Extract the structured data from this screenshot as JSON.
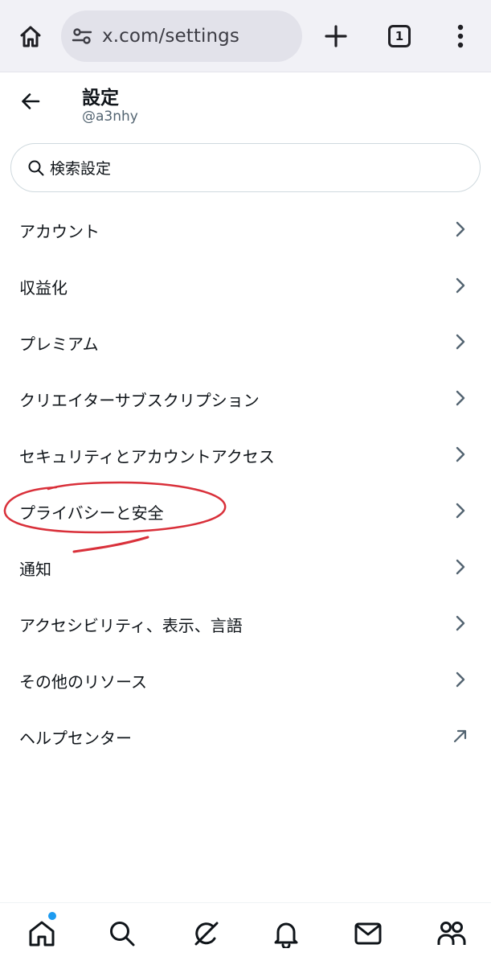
{
  "browser": {
    "url": "x.com/settings",
    "tab_count": "1",
    "icons": [
      "home-icon",
      "site-settings-icon",
      "plus-icon",
      "tab-count-icon",
      "more-vert-icon"
    ]
  },
  "header": {
    "title": "設定",
    "handle": "@a3nhy"
  },
  "search": {
    "placeholder": "検索設定"
  },
  "settings": {
    "items": [
      {
        "label": "アカウント",
        "icon": "chevron-right-icon"
      },
      {
        "label": "収益化",
        "icon": "chevron-right-icon"
      },
      {
        "label": "プレミアム",
        "icon": "chevron-right-icon"
      },
      {
        "label": "クリエイターサブスクリプション",
        "icon": "chevron-right-icon"
      },
      {
        "label": "セキュリティとアカウントアクセス",
        "icon": "chevron-right-icon"
      },
      {
        "label": "プライバシーと安全",
        "icon": "chevron-right-icon"
      },
      {
        "label": "通知",
        "icon": "chevron-right-icon"
      },
      {
        "label": "アクセシビリティ、表示、言語",
        "icon": "chevron-right-icon"
      },
      {
        "label": "その他のリソース",
        "icon": "chevron-right-icon"
      },
      {
        "label": "ヘルプセンター",
        "icon": "external-link-icon"
      }
    ]
  },
  "bottom_nav": {
    "items": [
      "home-icon",
      "search-icon",
      "grok-icon",
      "notifications-icon",
      "messages-icon",
      "communities-icon"
    ]
  },
  "colors": {
    "text": "#0f1419",
    "secondary_text": "#536471",
    "chevron": "#536471",
    "annotation": "#d9303a",
    "notification_dot": "#1d9bf0"
  }
}
